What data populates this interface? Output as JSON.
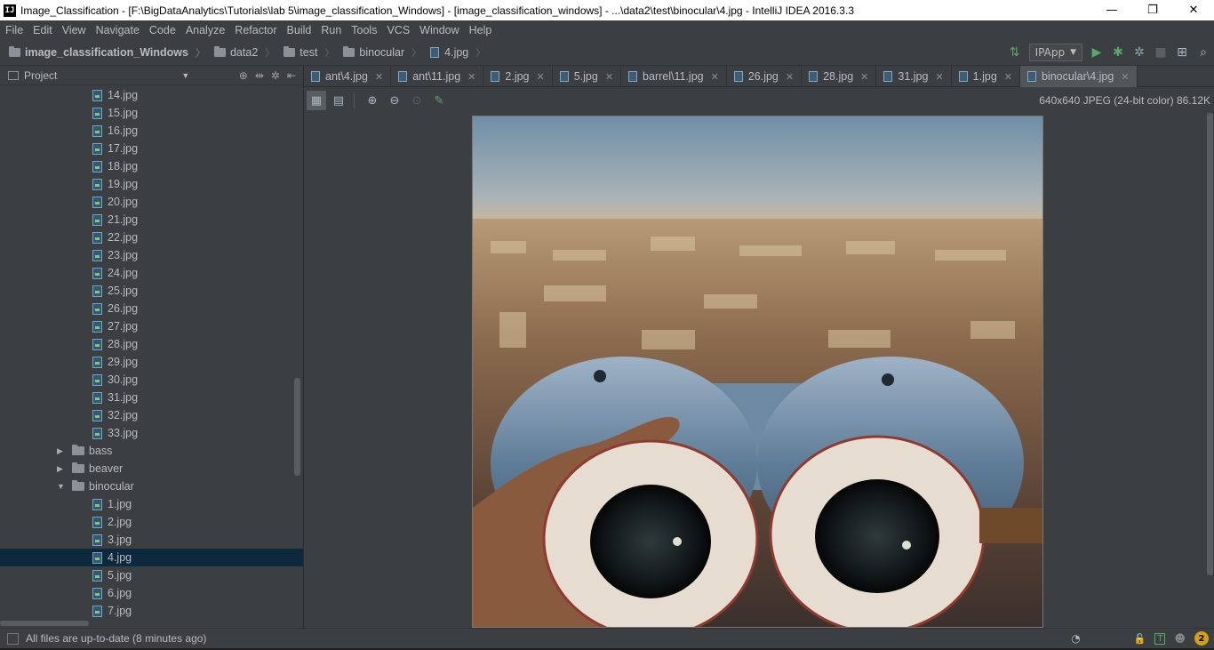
{
  "window": {
    "title": "Image_Classification - [F:\\BigDataAnalytics\\Tutorials\\lab 5\\image_classification_Windows] - [image_classification_windows] - ...\\data2\\test\\binocular\\4.jpg - IntelliJ IDEA 2016.3.3",
    "app_icon_text": "IJ",
    "minimize": "—",
    "restore": "❐",
    "close": "✕"
  },
  "menu": [
    "File",
    "Edit",
    "View",
    "Navigate",
    "Code",
    "Analyze",
    "Refactor",
    "Build",
    "Run",
    "Tools",
    "VCS",
    "Window",
    "Help"
  ],
  "breadcrumb": [
    "image_classification_Windows",
    "data2",
    "test",
    "binocular",
    "4.jpg"
  ],
  "toolbar": {
    "run_config": "IPApp",
    "run_icon": "▶",
    "debug_icon": "✱",
    "coverage_icon": "✲",
    "stop_icon": "■",
    "structure_icon": "⊞",
    "search_icon": "⌕"
  },
  "project_panel": {
    "title": "Project",
    "tools": [
      "⊕",
      "⇹",
      "✲",
      "⇤"
    ]
  },
  "tree": {
    "files_before": [
      "14.jpg",
      "15.jpg",
      "16.jpg",
      "17.jpg",
      "18.jpg",
      "19.jpg",
      "20.jpg",
      "21.jpg",
      "22.jpg",
      "23.jpg",
      "24.jpg",
      "25.jpg",
      "26.jpg",
      "27.jpg",
      "28.jpg",
      "29.jpg",
      "30.jpg",
      "31.jpg",
      "32.jpg",
      "33.jpg"
    ],
    "folders": [
      "bass",
      "beaver",
      "binocular"
    ],
    "binocular_files": [
      "1.jpg",
      "2.jpg",
      "3.jpg",
      "4.jpg",
      "5.jpg",
      "6.jpg",
      "7.jpg"
    ],
    "selected": "4.jpg"
  },
  "tabs": [
    "ant\\4.jpg",
    "ant\\11.jpg",
    "2.jpg",
    "5.jpg",
    "barrel\\11.jpg",
    "26.jpg",
    "28.jpg",
    "31.jpg",
    "1.jpg",
    "binocular\\4.jpg"
  ],
  "active_tab": "binocular\\4.jpg",
  "image_info": "640x640 JPEG (24-bit color) 86.12K",
  "status": {
    "text": "All files are up-to-date (8 minutes ago)",
    "notifications": "2"
  }
}
